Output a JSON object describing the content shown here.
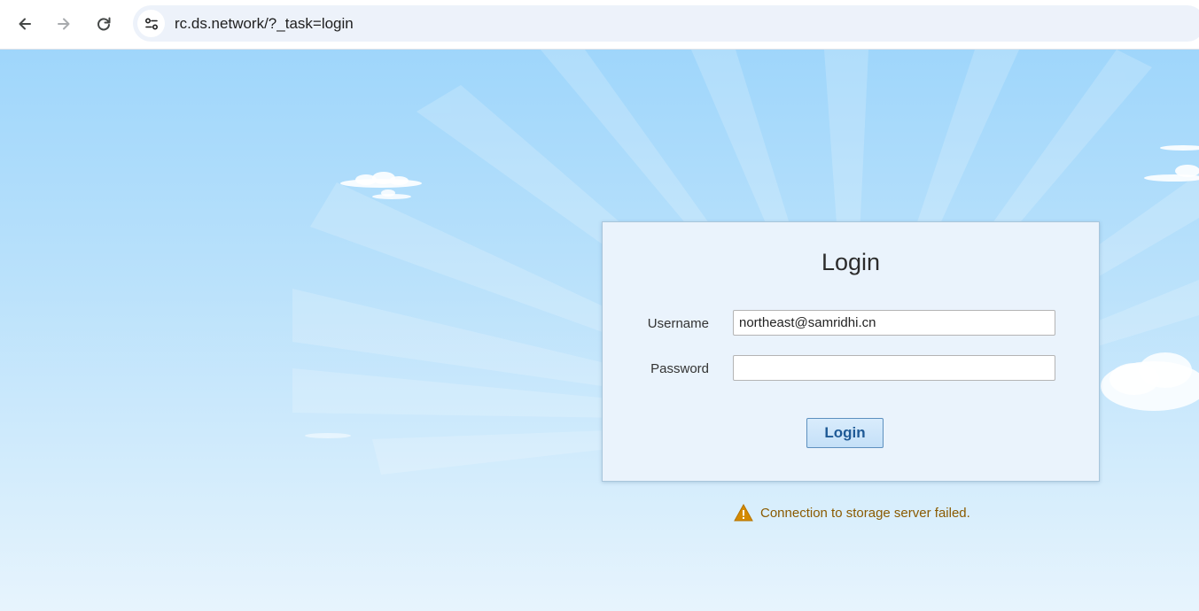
{
  "browser": {
    "url": "rc.ds.network/?_task=login",
    "back_icon": "arrow-left-icon",
    "forward_icon": "arrow-right-icon",
    "reload_icon": "reload-icon",
    "site_info_icon": "tune-icon"
  },
  "login": {
    "title": "Login",
    "username_label": "Username",
    "username_value": "northeast@samridhi.cn",
    "password_label": "Password",
    "password_value": "",
    "button_label": "Login"
  },
  "message": {
    "icon": "warning-icon",
    "text": "Connection to storage server failed."
  },
  "colors": {
    "sky_top": "#9fd6fb",
    "sky_bottom": "#e7f4fd",
    "login_box_bg": "#eaf3fc",
    "button_text": "#1f5a96",
    "warning_text": "#8a5a00",
    "warning_icon": "#d48a00"
  }
}
